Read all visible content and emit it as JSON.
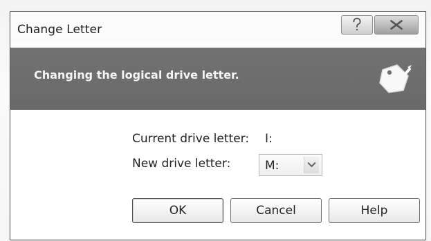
{
  "dialog": {
    "title": "Change Letter",
    "banner_text": "Changing the logical drive letter."
  },
  "window_controls": {
    "help_icon": "question-mark-icon",
    "close_icon": "close-icon"
  },
  "fields": {
    "current_label": "Current drive letter:",
    "current_value": "I:",
    "new_label": "New drive letter:",
    "new_value": "M:"
  },
  "buttons": {
    "ok_label": "OK",
    "cancel_label": "Cancel",
    "help_label": "Help"
  },
  "colors": {
    "banner": "#727272",
    "border": "#5f5f5f"
  },
  "icons": {
    "banner_icon": "tag-edit-icon",
    "dropdown_icon": "chevron-down-icon"
  }
}
